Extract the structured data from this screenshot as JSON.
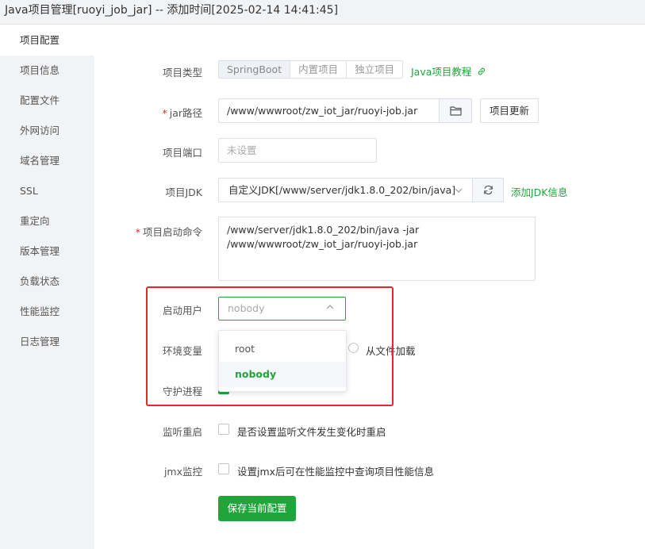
{
  "window": {
    "title": "Java项目管理[ruoyi_job_jar] -- 添加时间[2025-02-14 14:41:45]"
  },
  "sidebar": {
    "items": [
      {
        "label": "项目配置",
        "active": true
      },
      {
        "label": "项目信息"
      },
      {
        "label": "配置文件"
      },
      {
        "label": "外网访问"
      },
      {
        "label": "域名管理"
      },
      {
        "label": "SSL"
      },
      {
        "label": "重定向"
      },
      {
        "label": "版本管理"
      },
      {
        "label": "负载状态"
      },
      {
        "label": "性能监控"
      },
      {
        "label": "日志管理"
      }
    ]
  },
  "form": {
    "project_type": {
      "label": "项目类型",
      "options": [
        "SpringBoot",
        "内置项目",
        "独立项目"
      ],
      "selected": "SpringBoot",
      "tutorial_link": "Java项目教程"
    },
    "jar_path": {
      "required_mark": "*",
      "label": "jar路径",
      "value": "/www/wwwroot/zw_iot_jar/ruoyi-job.jar",
      "update_button": "项目更新"
    },
    "port": {
      "label": "项目端口",
      "placeholder": "未设置"
    },
    "jdk": {
      "label": "项目JDK",
      "value": "自定义JDK[/www/server/jdk1.8.0_202/bin/java]",
      "add_link": "添加JDK信息"
    },
    "start_command": {
      "required_mark": "*",
      "label": "项目启动命令",
      "line1": "/www/server/jdk1.8.0_202/bin/java -jar",
      "line2": "/www/wwwroot/zw_iot_jar/ruoyi-job.jar"
    },
    "start_user": {
      "label": "启动用户",
      "placeholder": "nobody",
      "options": [
        "root",
        "nobody"
      ],
      "selected": "nobody"
    },
    "env_vars": {
      "label": "环境变量",
      "option_file": "从文件加载"
    },
    "daemon": {
      "label": "守护进程",
      "checked": true
    },
    "watch_restart": {
      "label": "监听重启",
      "checkbox_text": "是否设置监听文件发生变化时重启",
      "checked": false
    },
    "jmx": {
      "label": "jmx监控",
      "checkbox_text": "设置jmx后可在性能监控中查询项目性能信息",
      "checked": false
    },
    "save_button": "保存当前配置"
  },
  "colors": {
    "accent": "#20a53a",
    "highlight": "#e5262b"
  }
}
